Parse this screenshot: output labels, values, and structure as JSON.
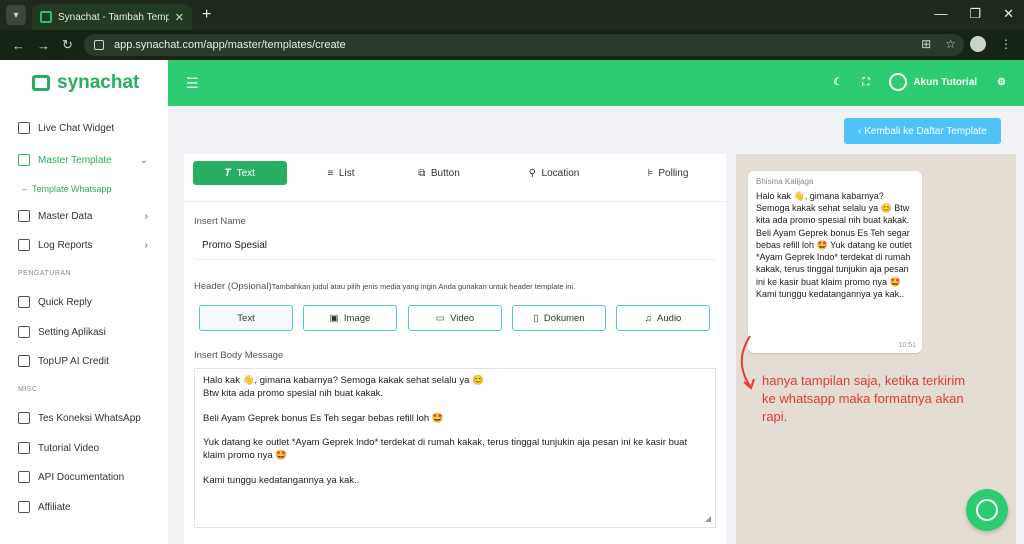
{
  "browser": {
    "tab_title": "Synachat - Tambah Template Pesan",
    "url": "app.synachat.com/app/master/templates/create"
  },
  "brand": {
    "name": "synachat",
    "color": "#27ae60"
  },
  "sidebar": {
    "items": [
      {
        "label": "Live Chat Widget",
        "icon": "chat-icon"
      },
      {
        "label": "Master Template",
        "icon": "template-icon",
        "active": true
      },
      {
        "label": "Template Whatsapp",
        "sub": true
      },
      {
        "label": "Master Data",
        "icon": "list-icon"
      },
      {
        "label": "Log Reports",
        "icon": "report-icon"
      },
      {
        "label": "Quick Reply",
        "icon": "reply-icon"
      },
      {
        "label": "Setting Aplikasi",
        "icon": "gear-icon"
      },
      {
        "label": "TopUP AI Credit",
        "icon": "card-icon"
      },
      {
        "label": "Tes Koneksi WhatsApp",
        "icon": "whatsapp-icon"
      },
      {
        "label": "Tutorial Video",
        "icon": "video-icon"
      },
      {
        "label": "API Documentation",
        "icon": "code-icon"
      },
      {
        "label": "Affiliate",
        "icon": "network-icon"
      }
    ],
    "sections": [
      "PENGATURAN",
      "MISC"
    ]
  },
  "topbar": {
    "user": "Akun Tutorial",
    "color": "#2ecc71"
  },
  "back_button": "Kembali ke Daftar Template",
  "tabs": [
    "Text",
    "List",
    "Button",
    "Location",
    "Polling"
  ],
  "form": {
    "name_label": "Insert Name",
    "name_value": "Promo Spesial",
    "header_label": "Header (Opsional)",
    "header_hint": "Tambahkan judul atau pilih jenis media yang ingin Anda gunakan untuk header template ini.",
    "header_buttons": [
      "Text",
      "Image",
      "Video",
      "Dokumen",
      "Audio"
    ],
    "body_label": "Insert Body Message",
    "body_lines": [
      "Halo kak 👋, gimana kabarnya? Semoga kakak sehat selalu ya 😊",
      "Btw kita ada promo spesial nih buat kakak.",
      "",
      "Beli Ayam Geprek bonus Es Teh segar bebas refill loh 🤩",
      "",
      "Yuk datang ke outlet *Ayam Geprek Indo* terdekat di rumah kakak, terus tinggal tunjukin aja pesan ini ke kasir buat klaim promo nya 🤩",
      "",
      "Kami tunggu kedatangannya ya kak.."
    ]
  },
  "preview": {
    "sender": "Bhisma Kalijaga",
    "message": "Halo kak 👋, gimana kabarnya? Semoga kakak sehat selalu ya 😊 Btw kita ada promo spesial nih buat kakak. Beli Ayam Geprek bonus Es Teh segar bebas refill loh 🤩 Yuk datang ke outlet *Ayam Geprek Indo* terdekat di rumah kakak, terus tinggal tunjukin aja pesan ini ke kasir buat klaim promo nya 🤩 Kami tunggu kedatangannya ya kak..",
    "time": "10:51",
    "note": "hanya tampilan saja, ketika terkirim ke whatsapp maka formatnya akan rapi."
  }
}
